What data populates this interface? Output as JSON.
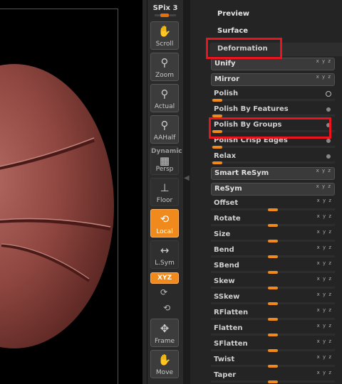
{
  "shelf": {
    "spix_label": "SPix 3",
    "spix_value": 3,
    "buttons": [
      {
        "key": "scroll",
        "label": "Scroll",
        "icon": "hand-grid-icon",
        "glyph": "✋"
      },
      {
        "key": "zoom",
        "label": "Zoom",
        "icon": "magnifier-plus-icon",
        "glyph": "⚲"
      },
      {
        "key": "actual",
        "label": "Actual",
        "icon": "magnifier-grid-icon",
        "glyph": "⚲"
      },
      {
        "key": "aahalf",
        "label": "AAHalf",
        "icon": "magnifier-half-icon",
        "glyph": "⚲"
      },
      {
        "key": "persp",
        "label": "Persp",
        "top_label": "Dynamic",
        "icon": "perspective-grid-icon",
        "glyph": "▦"
      },
      {
        "key": "floor",
        "label": "Floor",
        "icon": "floor-icon",
        "glyph": "⊥"
      },
      {
        "key": "local",
        "label": "Local",
        "icon": "local-orbit-icon",
        "glyph": "⟲"
      },
      {
        "key": "lsym",
        "label": "L.Sym",
        "icon": "local-symmetry-icon",
        "glyph": "↔"
      },
      {
        "key": "frame",
        "label": "Frame",
        "icon": "frame-icon",
        "glyph": "✥"
      },
      {
        "key": "move",
        "label": "Move",
        "icon": "move-hand-icon",
        "glyph": "✋"
      }
    ],
    "xyz_label": "XYZ"
  },
  "palette": {
    "top_items": [
      "Preview",
      "Surface"
    ],
    "section_title": "Deformation",
    "rows": [
      {
        "label": "Unify",
        "kind": "button",
        "axes": "x y z"
      },
      {
        "label": "Mirror",
        "kind": "button",
        "axes": "x y z"
      },
      {
        "label": "Polish",
        "kind": "slider",
        "value": 0,
        "indicator": "ring"
      },
      {
        "label": "Polish By Features",
        "kind": "slider",
        "value": 0,
        "indicator": "dot"
      },
      {
        "label": "Polish By Groups",
        "kind": "slider",
        "value": 0,
        "indicator": "dot"
      },
      {
        "label": "Polish Crisp Edges",
        "kind": "slider",
        "value": 0,
        "indicator": "dot"
      },
      {
        "label": "Relax",
        "kind": "slider",
        "value": 0,
        "indicator": "dot"
      },
      {
        "label": "Smart ReSym",
        "kind": "button",
        "axes": "x y z"
      },
      {
        "label": "ReSym",
        "kind": "button",
        "axes": "x y z"
      },
      {
        "label": "Offset",
        "kind": "slider",
        "value": 0,
        "axes": "x y z"
      },
      {
        "label": "Rotate",
        "kind": "slider",
        "value": 0,
        "axes": "x y z"
      },
      {
        "label": "Size",
        "kind": "slider",
        "value": 0,
        "axes": "x y z"
      },
      {
        "label": "Bend",
        "kind": "slider",
        "value": 0,
        "axes": "x y z"
      },
      {
        "label": "SBend",
        "kind": "slider",
        "value": 0,
        "axes": "x y z"
      },
      {
        "label": "Skew",
        "kind": "slider",
        "value": 0,
        "axes": "x y z"
      },
      {
        "label": "SSkew",
        "kind": "slider",
        "value": 0,
        "axes": "x y z"
      },
      {
        "label": "RFlatten",
        "kind": "slider",
        "value": 0,
        "axes": "x y z"
      },
      {
        "label": "Flatten",
        "kind": "slider",
        "value": 0,
        "axes": "x y z"
      },
      {
        "label": "SFlatten",
        "kind": "slider",
        "value": 0,
        "axes": "x y z"
      },
      {
        "label": "Twist",
        "kind": "slider",
        "value": 0,
        "axes": "x y z"
      },
      {
        "label": "Taper",
        "kind": "slider",
        "value": 0,
        "axes": "x y z"
      }
    ]
  },
  "colors": {
    "accent": "#f08a1c",
    "highlight": "#e8141e",
    "mesh": "#8a3c37"
  }
}
